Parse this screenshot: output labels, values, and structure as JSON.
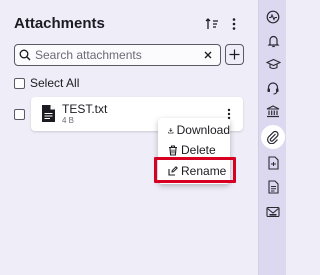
{
  "panel": {
    "title": "Attachments",
    "sort_icon": "sort-icon",
    "more_icon": "kebab-icon"
  },
  "search": {
    "placeholder": "Search attachments",
    "value": "",
    "clear_icon": "close-icon",
    "add_icon": "plus-icon"
  },
  "select_all": {
    "label": "Select All",
    "checked": false
  },
  "files": [
    {
      "name": "TEST.txt",
      "size": "4 B",
      "icon": "document-icon",
      "checked": false
    }
  ],
  "context_menu": {
    "items": [
      {
        "label": "Download",
        "icon": "download-icon"
      },
      {
        "label": "Delete",
        "icon": "trash-icon"
      },
      {
        "label": "Rename",
        "icon": "edit-icon"
      }
    ],
    "highlighted_item": "Rename",
    "highlight_color": "#d70022"
  },
  "sidebar_rail": {
    "icons": [
      "activity-icon",
      "bell-icon",
      "graduation-cap-icon",
      "headset-icon",
      "bank-icon",
      "paperclip-icon",
      "document-icon",
      "list-document-icon",
      "mail-icon"
    ],
    "active": "paperclip-icon"
  },
  "colors": {
    "panel_bg": "#efedf7",
    "rail_bg": "#dcd8f0",
    "accent": "#0060df",
    "highlight": "#d70022"
  }
}
